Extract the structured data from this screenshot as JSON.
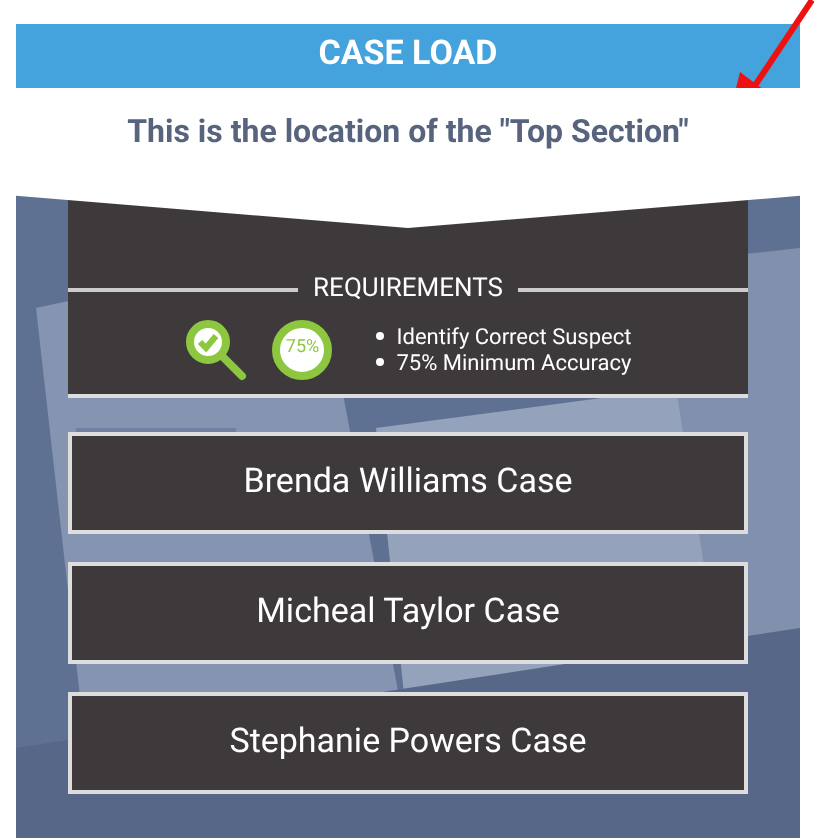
{
  "header": {
    "title": "CASE LOAD"
  },
  "top_section": {
    "text": "This is the location of the \"Top Section\""
  },
  "requirements": {
    "title": "REQUIREMENTS",
    "badge": "75%",
    "items": [
      "Identify Correct Suspect",
      "75% Minimum Accuracy"
    ]
  },
  "cases": [
    {
      "label": "Brenda Williams Case"
    },
    {
      "label": "Micheal Taylor Case"
    },
    {
      "label": "Stephanie Powers Case"
    }
  ]
}
